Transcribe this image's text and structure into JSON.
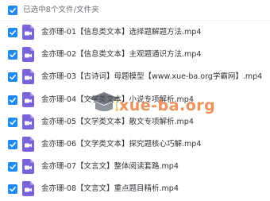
{
  "header": {
    "selected_label": "已选中8个文件/文件夹"
  },
  "files": [
    {
      "name": "金亦珊-01【信息类文本】选择题解题方法.mp4"
    },
    {
      "name": "金亦珊-02【信息类文本】主观题通识方法.mp4"
    },
    {
      "name": "金亦珊-03【古诗词】母题模型【www.xue-ba.org学霸网】.mp4"
    },
    {
      "name": "金亦珊-04【文学类文本】小说专项解析.mp4"
    },
    {
      "name": "金亦珊-05【文学类文本】散文专项解析.mp4"
    },
    {
      "name": "金亦珊-06【文学类文本】探究题核心巧解.mp4"
    },
    {
      "name": "金亦珊-07【文言文】整体阅读套路.mp4"
    },
    {
      "name": "金亦珊-08【文言文】重点题目精析.mp4"
    }
  ],
  "watermark": {
    "text": "xue-ba.org"
  },
  "colors": {
    "checkbox": "#1f8bf0",
    "video_icon": "#7a63d8",
    "watermark": "#e86f2c"
  },
  "icons": {
    "checkbox": "checkmark-icon",
    "file": "video-file-icon"
  }
}
